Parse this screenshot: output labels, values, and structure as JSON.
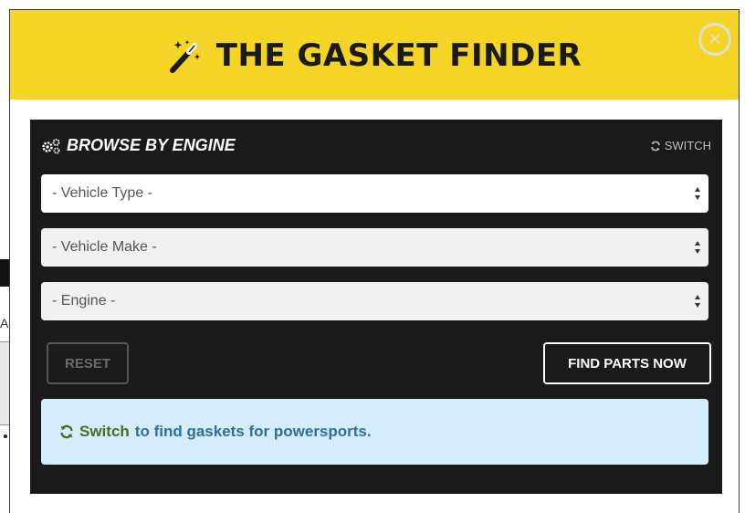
{
  "modal": {
    "title": "THE GASKET FINDER",
    "close_icon": "close-icon"
  },
  "browse": {
    "heading": "BROWSE BY ENGINE",
    "switch_label": "SWITCH"
  },
  "selects": {
    "vehicle_type": "- Vehicle Type -",
    "vehicle_make": "- Vehicle Make -",
    "engine": "- Engine -"
  },
  "buttons": {
    "reset": "RESET",
    "find": "FIND PARTS NOW"
  },
  "info": {
    "switch_text": "Switch",
    "rest_text": "to find gaskets for powersports."
  },
  "background": {
    "partial_letter": "A"
  },
  "colors": {
    "header_yellow": "#f4d424",
    "panel_dark": "#1a1a1a",
    "info_bg": "#d3eef8",
    "info_link": "#2f6f9a"
  }
}
